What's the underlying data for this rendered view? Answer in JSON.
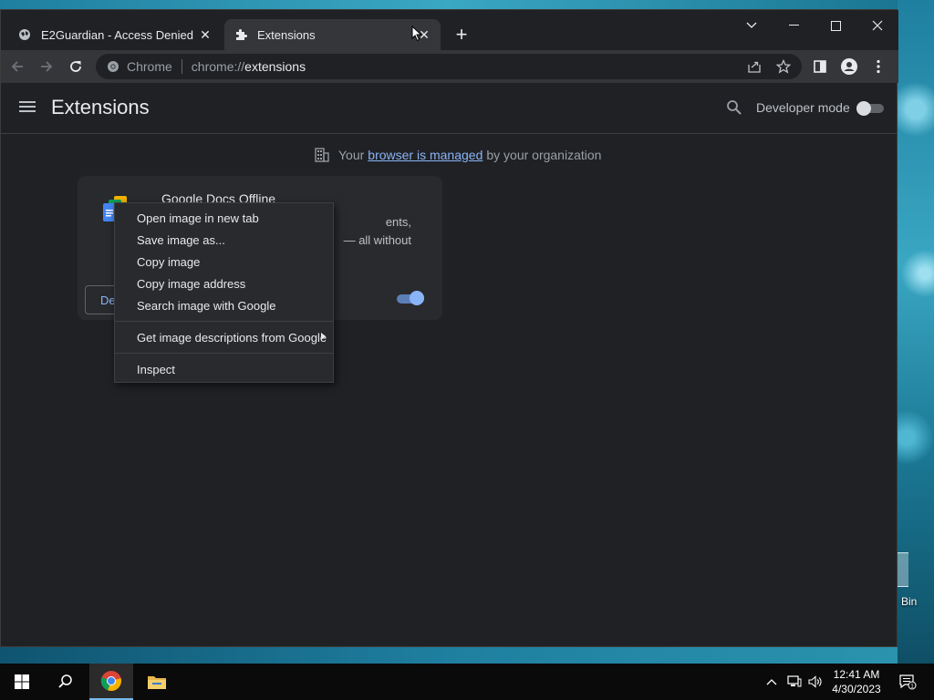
{
  "window": {
    "tabs": [
      {
        "title": "E2Guardian - Access Denied",
        "icon": "globe-icon",
        "close": "✕"
      },
      {
        "title": "Extensions",
        "icon": "puzzle-icon",
        "close": "✕"
      }
    ],
    "new_tab": "+"
  },
  "toolbar": {
    "chip_label": "Chrome",
    "url_scheme": "chrome://",
    "url_host": "extensions"
  },
  "page": {
    "title": "Extensions",
    "developer_mode_label": "Developer mode",
    "developer_mode_on": false,
    "managed": {
      "prefix": "Your",
      "link": "browser is managed",
      "suffix": "by your organization"
    }
  },
  "extension_card": {
    "name": "Google Docs Offline",
    "description_line1": "ents,",
    "description_line2": "— all without",
    "details_button": "De",
    "enabled": true
  },
  "context_menu": {
    "items": [
      "Open image in new tab",
      "Save image as...",
      "Copy image",
      "Copy image address",
      "Search image with Google",
      "Get image descriptions from Google",
      "Inspect"
    ]
  },
  "desktop": {
    "recycle_bin_label": "Bin"
  },
  "taskbar": {
    "time": "12:41 AM",
    "date": "4/30/2023",
    "notification_count": "1"
  },
  "colors": {
    "accent": "#8ab4f8",
    "chrome_dark_bg": "#202124",
    "toolbar_bg": "#35363a",
    "card_bg": "#292a2d"
  }
}
